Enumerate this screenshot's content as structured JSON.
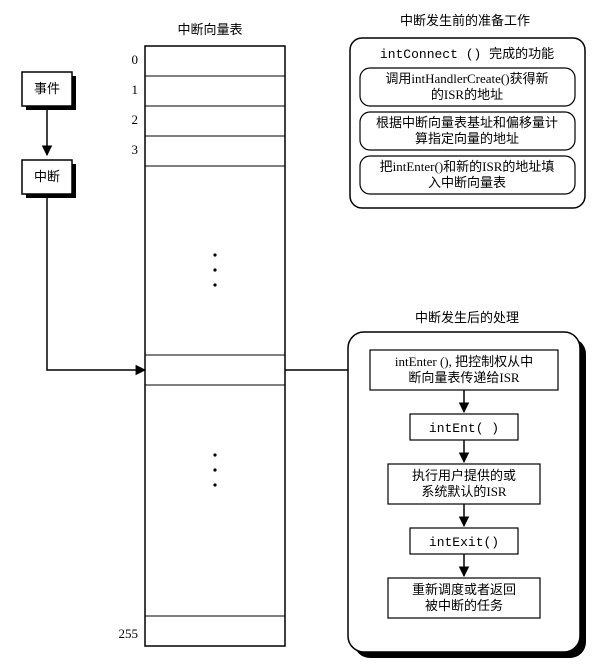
{
  "events": {
    "event_label": "事件",
    "interrupt_label": "中断"
  },
  "table": {
    "title": "中断向量表",
    "rows": [
      "0",
      "1",
      "2",
      "3",
      "255"
    ]
  },
  "prep": {
    "title": "中断发生前的准备工作",
    "subtitle": "intConnect () 完成的功能",
    "step1a": "调用intHandlerCreate()获得新",
    "step1b": "的ISR的地址",
    "step2a": "根据中断向量表基址和偏移量计",
    "step2b": "算指定向量的地址",
    "step3a": "把intEnter()和新的ISR的地址填",
    "step3b": "入中断向量表"
  },
  "handle": {
    "title": "中断发生后的处理",
    "s1a": "intEnter (), 把控制权从中",
    "s1b": "断向量表传递给ISR",
    "s2": "intEnt( )",
    "s3a": "执行用户提供的或",
    "s3b": "系统默认的ISR",
    "s4": "intExit()",
    "s5a": "重新调度或者返回",
    "s5b": "被中断的任务"
  }
}
